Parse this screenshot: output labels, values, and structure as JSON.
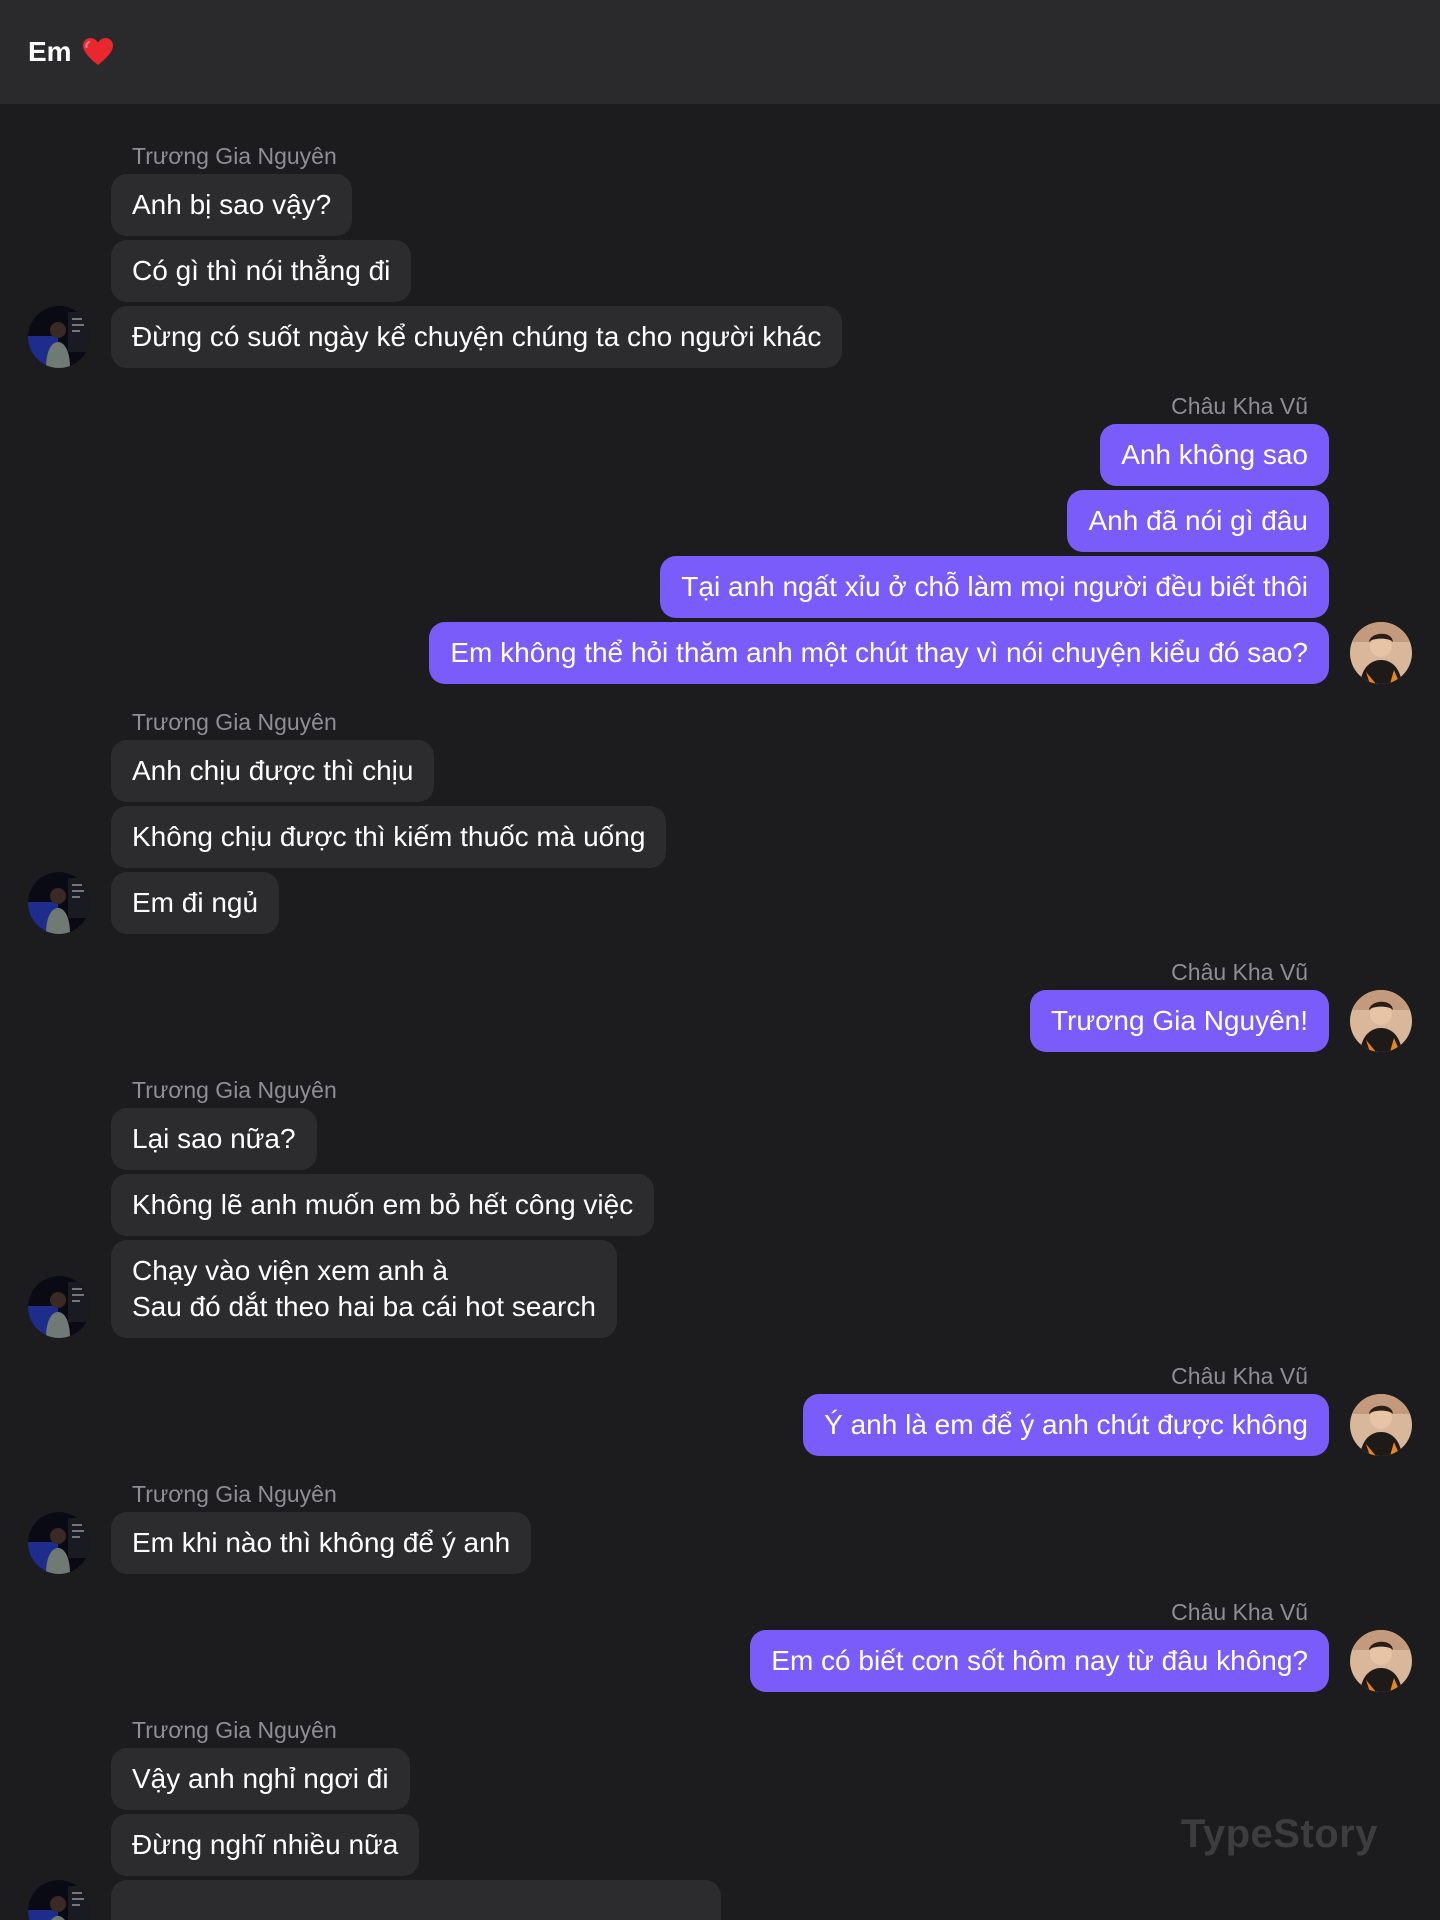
{
  "header": {
    "title": "Em",
    "title_icon": "red-heart-icon"
  },
  "colors": {
    "sent_bubble": "#7a5cfa",
    "received_bubble": "#2c2c2e",
    "background": "#1c1c1e",
    "header": "#2a2a2c"
  },
  "watermark": "TypeStory",
  "conversation": [
    {
      "side": "recv",
      "sender": "Trương Gia Nguyên",
      "messages": [
        "Anh bị sao vậy?",
        "Có gì thì nói thẳng đi",
        "Đừng có suốt ngày kể chuyện chúng ta cho người khác"
      ]
    },
    {
      "side": "sent",
      "sender": "Châu Kha Vũ",
      "messages": [
        "Anh không sao",
        "Anh đã nói gì đâu",
        "Tại anh ngất xỉu ở chỗ làm mọi người đều biết thôi",
        "Em không thể hỏi thăm anh một chút thay vì nói chuyện kiểu đó sao?"
      ]
    },
    {
      "side": "recv",
      "sender": "Trương Gia Nguyên",
      "messages": [
        "Anh chịu được thì chịu",
        "Không chịu được thì kiếm thuốc mà uống",
        "Em đi ngủ"
      ]
    },
    {
      "side": "sent",
      "sender": "Châu Kha Vũ",
      "messages": [
        "Trương Gia Nguyên!"
      ]
    },
    {
      "side": "recv",
      "sender": "Trương Gia Nguyên",
      "messages": [
        "Lại sao nữa?",
        "Không lẽ anh muốn em bỏ hết công việc",
        "Chạy vào viện xem anh à\nSau đó dắt theo hai ba cái hot search"
      ]
    },
    {
      "side": "sent",
      "sender": "Châu Kha Vũ",
      "messages": [
        "Ý anh là em để ý anh chút được không"
      ]
    },
    {
      "side": "recv",
      "sender": "Trương Gia Nguyên",
      "messages": [
        "Em khi nào thì không để ý anh"
      ]
    },
    {
      "side": "sent",
      "sender": "Châu Kha Vũ",
      "messages": [
        "Em có biết cơn sốt hôm nay từ đâu không?"
      ]
    },
    {
      "side": "recv",
      "sender": "Trương Gia Nguyên",
      "messages": [
        "Vậy anh nghỉ ngơi đi",
        "Đừng nghĩ nhiều nữa",
        ""
      ]
    }
  ]
}
